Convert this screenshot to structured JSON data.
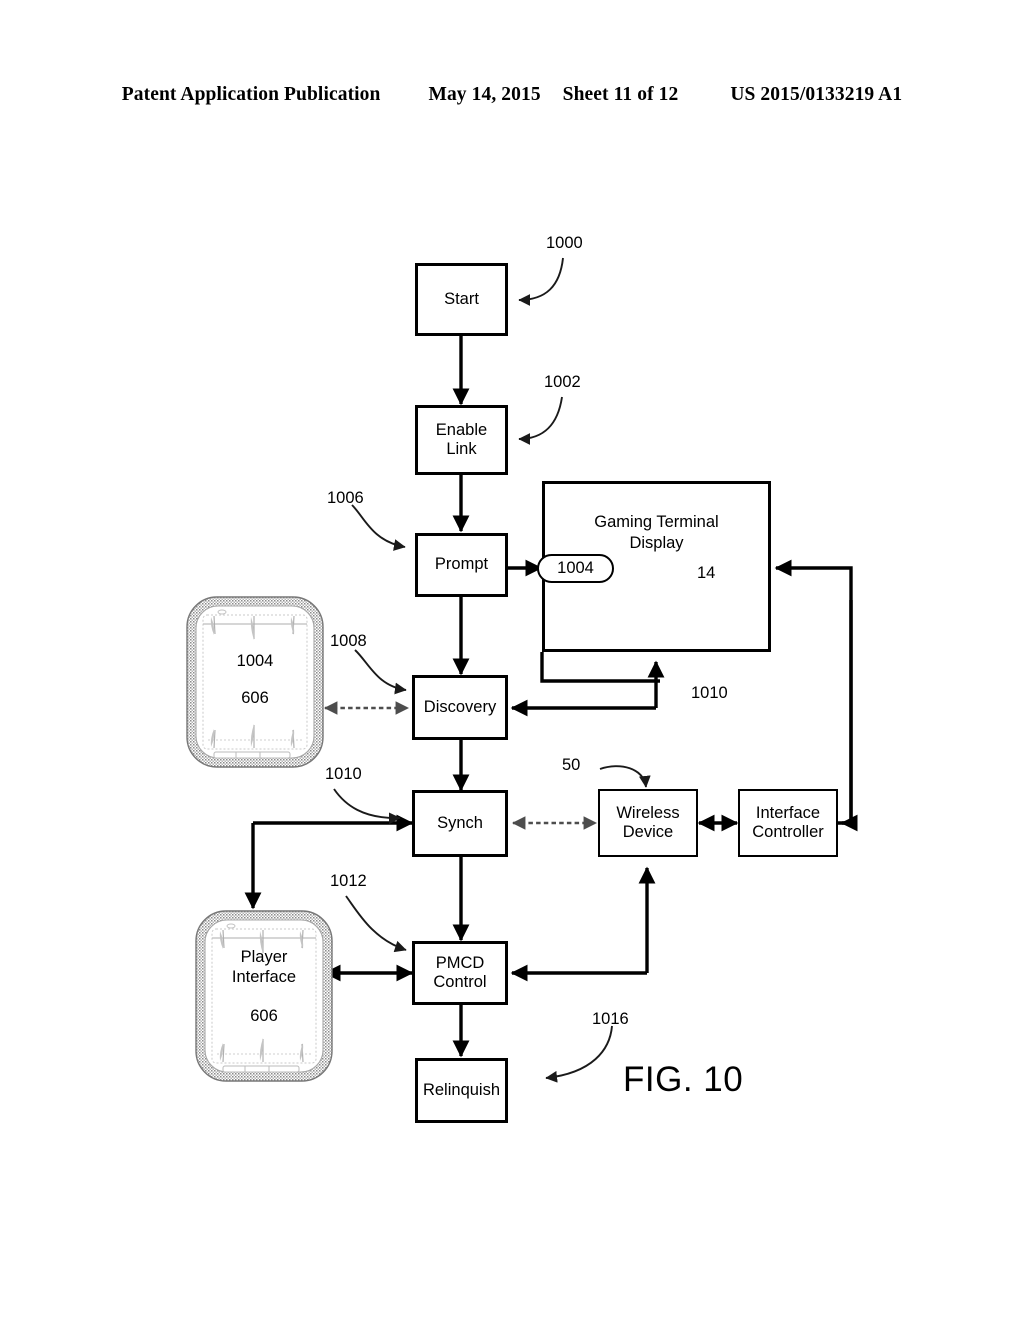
{
  "header": {
    "publication": "Patent Application Publication",
    "date": "May 14, 2015",
    "sheet": "Sheet 11 of 12",
    "docnum": "US 2015/0133219 A1"
  },
  "figure": {
    "caption": "FIG. 10",
    "nodes": {
      "start": "Start",
      "enable_link": "Enable\nLink",
      "prompt": "Prompt",
      "discovery": "Discovery",
      "synch": "Synch",
      "pmcd_control": "PMCD\nControl",
      "relinquish": "Relinquish",
      "wireless_device": "Wireless\nDevice",
      "interface_controller": "Interface\nController"
    },
    "gaming_terminal": {
      "title": "Gaming Terminal\nDisplay",
      "pill_label": "1004",
      "number": "14"
    },
    "devices": [
      {
        "id": "pmcd-device-top",
        "line1": "1004",
        "line2": "606"
      },
      {
        "id": "pmcd-device-bottom",
        "line1": "Player\nInterface",
        "line2": "606"
      }
    ],
    "refs": [
      {
        "id": "ref-1000",
        "text": "1000"
      },
      {
        "id": "ref-1002",
        "text": "1002"
      },
      {
        "id": "ref-1006",
        "text": "1006"
      },
      {
        "id": "ref-1008",
        "text": "1008"
      },
      {
        "id": "ref-1010-discovery",
        "text": "1010"
      },
      {
        "id": "ref-1010-synch",
        "text": "1010"
      },
      {
        "id": "ref-1012",
        "text": "1012"
      },
      {
        "id": "ref-1016",
        "text": "1016"
      },
      {
        "id": "ref-50",
        "text": "50"
      }
    ]
  },
  "colors": {
    "ink": "#000000",
    "paper": "#ffffff",
    "dashed_link": "#4d4d4d",
    "device_bezel": "#9a9a9a"
  }
}
